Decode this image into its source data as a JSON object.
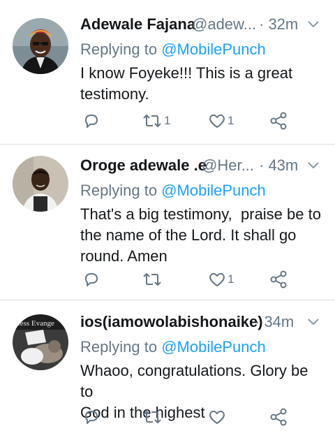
{
  "tweets": [
    {
      "name": "Adewale Fajana",
      "handle": "@adew...",
      "time": "· 32m",
      "replying_prefix": "Replying to ",
      "replying_to": "@MobilePunch",
      "text_lines": [
        "I know Foyeke!!! This is a great",
        "testimony."
      ],
      "retweets": "1",
      "likes": "1"
    },
    {
      "name": "Oroge adewale .e",
      "handle": "@Her...",
      "time": "· 43m",
      "replying_prefix": "Replying to ",
      "replying_to": "@MobilePunch",
      "text_lines": [
        "That's a big testimony,  praise be to",
        "the name of the Lord. It shall go",
        "round. Amen"
      ],
      "retweets": "",
      "likes": "1"
    },
    {
      "name": "ios(iamowolabishonaike)",
      "handle": "",
      "time": "· 34m",
      "replying_prefix": "Replying to ",
      "replying_to": "@MobilePunch",
      "text_lines": [
        "Whaoo, congratulations. Glory be to",
        "God in the highest"
      ],
      "retweets": "",
      "likes": ""
    }
  ],
  "avatar3_caption": "rless Evange",
  "icons": {
    "reply": "reply-icon",
    "retweet": "retweet-icon",
    "like": "heart-icon",
    "share": "share-icon",
    "caret": "chevron-down-icon"
  },
  "colors": {
    "accent": "#1da1f2",
    "secondary_text": "#657786",
    "primary_text": "#14171a",
    "divider": "#d9dde2"
  }
}
